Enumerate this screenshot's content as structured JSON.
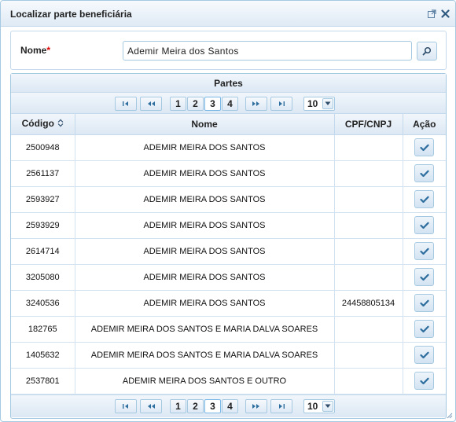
{
  "dialog": {
    "title": "Localizar parte beneficiária",
    "icons": [
      "popout-icon",
      "close-icon"
    ]
  },
  "form": {
    "name_label": "Nome",
    "required_mark": "*",
    "name_value": "Ademir Meira dos Santos",
    "search_icon": "search-icon"
  },
  "grid": {
    "caption": "Partes",
    "columns": {
      "code": "Código",
      "name": "Nome",
      "doc": "CPF/CNPJ",
      "action": "Ação"
    },
    "pages": [
      "1",
      "2",
      "3",
      "4"
    ],
    "current_page": "3",
    "rows_per_page": "10",
    "rows": [
      {
        "code": "2500948",
        "name": "ADEMIR MEIRA DOS SANTOS",
        "doc": ""
      },
      {
        "code": "2561137",
        "name": "ADEMIR MEIRA DOS SANTOS",
        "doc": ""
      },
      {
        "code": "2593927",
        "name": "ADEMIR MEIRA DOS SANTOS",
        "doc": ""
      },
      {
        "code": "2593929",
        "name": "ADEMIR MEIRA DOS SANTOS",
        "doc": ""
      },
      {
        "code": "2614714",
        "name": "ADEMIR MEIRA DOS SANTOS",
        "doc": ""
      },
      {
        "code": "3205080",
        "name": "ADEMIR MEIRA DOS SANTOS",
        "doc": ""
      },
      {
        "code": "3240536",
        "name": "ADEMIR MEIRA DOS SANTOS",
        "doc": "24458805134"
      },
      {
        "code": "182765",
        "name": "ADEMIR MEIRA DOS SANTOS E MARIA DALVA SOARES",
        "doc": ""
      },
      {
        "code": "1405632",
        "name": "ADEMIR MEIRA DOS SANTOS E MARIA DALVA SOARES",
        "doc": ""
      },
      {
        "code": "2537801",
        "name": "ADEMIR MEIRA DOS SANTOS E OUTRO",
        "doc": ""
      }
    ]
  },
  "colors": {
    "border": "#a6c9e2",
    "header_bg": "#dce8f4",
    "check": "#2e6e9e",
    "required": "#dd0000"
  }
}
